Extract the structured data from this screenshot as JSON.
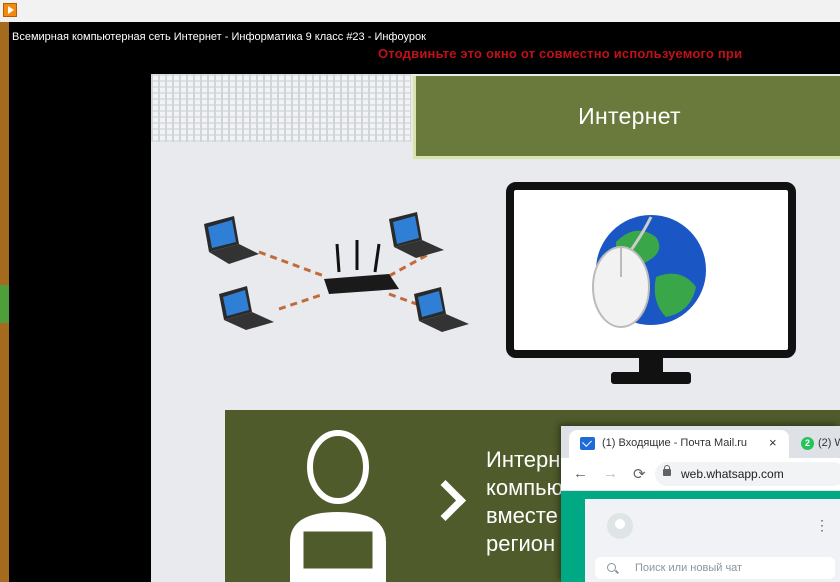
{
  "video": {
    "title": "Всемирная компьютерная сеть Интернет - Информатика 9 класс #23 - Инфоурок",
    "overlay_warning": "Отодвиньте это окно от совместно используемого при"
  },
  "slide": {
    "title": "Интернет",
    "band_lines": [
      "Интерн",
      "компью",
      "вместе",
      "регион"
    ]
  },
  "browser": {
    "tabs": [
      {
        "title": "(1) Входящие - Почта Mail.ru",
        "close": "×"
      },
      {
        "title": "(2) W",
        "badge": "2"
      }
    ],
    "nav": {
      "back": "←",
      "forward": "→",
      "reload": "⟳"
    },
    "url": "web.whatsapp.com",
    "search_placeholder": "Поиск или новый чат",
    "menu_glyph": "⋮"
  },
  "colors": {
    "slide_green": "#6a7a3d",
    "band_green": "#4f5b2b",
    "warning_red": "#c0101a",
    "whatsapp_green": "#00a884"
  }
}
